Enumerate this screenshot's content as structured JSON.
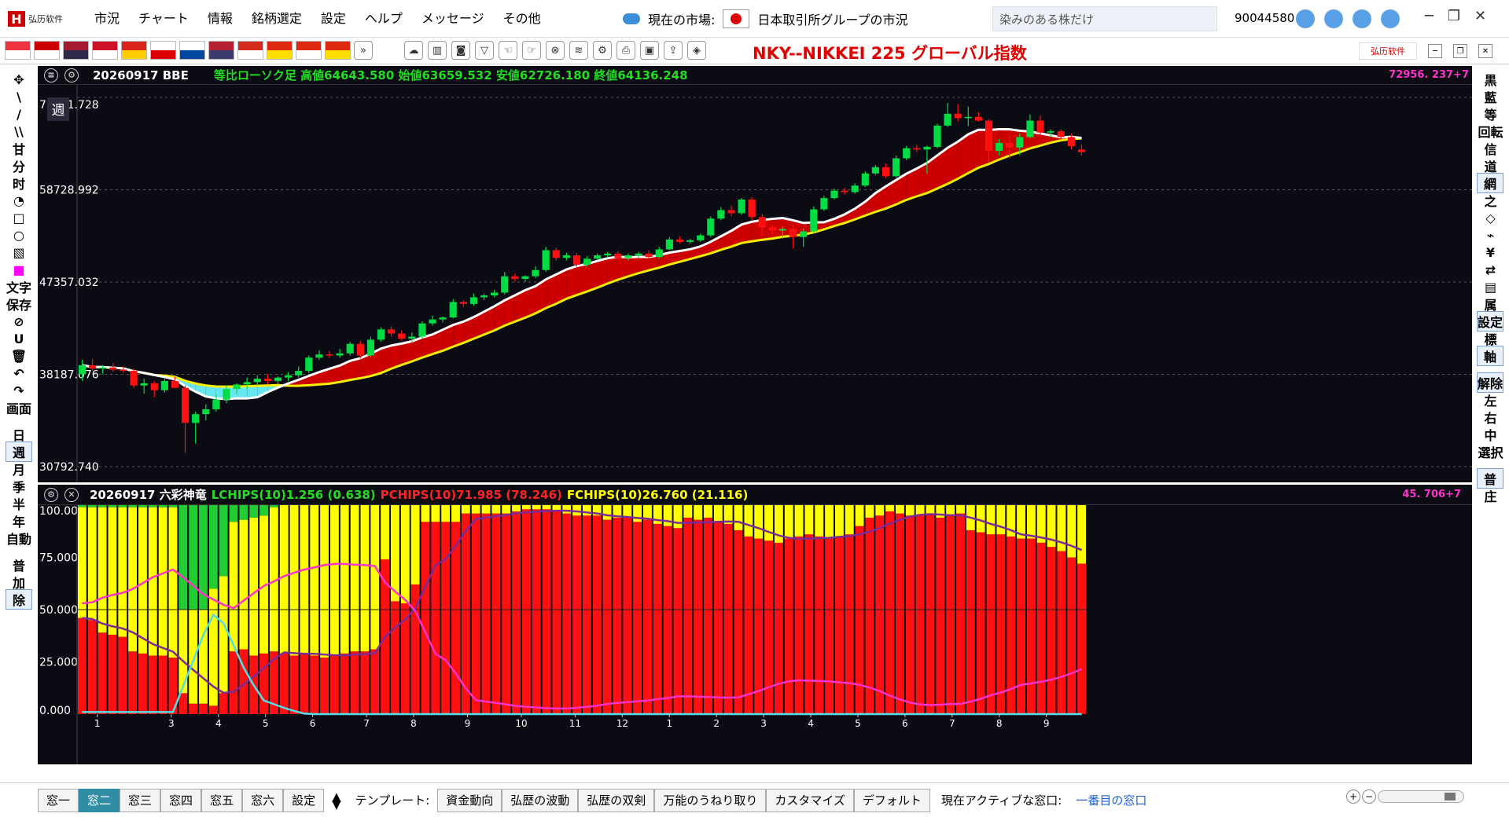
{
  "app": {
    "logo_text": "弘历软件",
    "menus": [
      "市況",
      "チャート",
      "情報",
      "銘柄選定",
      "設定",
      "ヘルプ",
      "メッセージ",
      "その他"
    ],
    "market_label": "現在の市場:",
    "market_name": "日本取引所グループの市況",
    "search_placeholder": "染みのある株だけ",
    "user_id": "90044580"
  },
  "toolbar": {
    "chart_title": "NKY--NIKKEI 225  グローバル指数",
    "flags": [
      "sg",
      "my",
      "th",
      "id",
      "vn",
      "jp",
      "kr",
      "us",
      "ca",
      "cn",
      "hk",
      "cn2"
    ]
  },
  "left_tools": [
    "✥",
    "\\",
    "/",
    "\\\\",
    "甘",
    "分",
    "时",
    "◔",
    "□",
    "○",
    "▧",
    "■",
    "文字",
    "保存",
    "⊘",
    "U",
    "🗑",
    "↶",
    "↷",
    "画面",
    "日",
    "週",
    "月",
    "季",
    "半",
    "年",
    "自動",
    "普",
    "加",
    "除"
  ],
  "right_tools": [
    "黒",
    "藍",
    "等",
    "回転",
    "信",
    "道",
    "網",
    "之",
    "◇",
    "⌁",
    "¥",
    "⇄",
    "▤",
    "属",
    "設定",
    "標",
    "軸",
    "解除",
    "左",
    "右",
    "中",
    "選択",
    "普",
    "庄"
  ],
  "upper": {
    "date_code": "20260917 BBE",
    "ohlc": "等比ローソク足 高値64643.580 始値63659.532 安値62726.180 終値64136.248",
    "right_value": "72956. 237+7",
    "period_badge": "週",
    "y_labels": [
      "72831.728",
      "58728.992",
      "47357.032",
      "38187.076",
      "30792.740"
    ]
  },
  "lower": {
    "date_code": "20260917 六彩神竜",
    "lchips": "LCHIPS(10)1.256 (0.638)",
    "pchips": "PCHIPS(10)71.985 (78.246)",
    "fchips": "FCHIPS(10)26.760 (21.116)",
    "right_value": "45. 706+7",
    "y_labels": [
      "100.000",
      "75.000",
      "50.000",
      "25.000",
      "0.000"
    ],
    "x_labels": [
      "1",
      "3",
      "4",
      "5",
      "6",
      "7",
      "8",
      "9",
      "10",
      "11",
      "12",
      "1",
      "2",
      "3",
      "4",
      "5",
      "6",
      "7",
      "8",
      "9"
    ]
  },
  "bottom": {
    "tabs": [
      "窓一",
      "窓二",
      "窓三",
      "窓四",
      "窓五",
      "窓六",
      "設定"
    ],
    "template_label": "テンプレート:",
    "templates": [
      "資金動向",
      "弘歴の波動",
      "弘歴の双剣",
      "万能のうねり取り",
      "カスタマイズ",
      "デフォルト"
    ],
    "active_label": "現在アクティブな窓口:",
    "active_value": "一番目の窓口"
  },
  "colors": {
    "up": "#00dd44",
    "down": "#ff1010",
    "yellow": "#ffff00",
    "white": "#ffffff",
    "cyan": "#55dde6",
    "magenta": "#ff33cc",
    "purple": "#7b2a9a"
  },
  "chart_data": [
    {
      "type": "candlestick",
      "ylim": [
        30792.74,
        72831.728
      ],
      "ylog": true,
      "y_ticks": [
        72831.728,
        58728.992,
        47357.032,
        38187.076,
        30792.74
      ],
      "candles": [
        [
          38200,
          39500,
          37600,
          39000
        ],
        [
          39000,
          39600,
          38500,
          38700
        ],
        [
          38700,
          39000,
          38200,
          38800
        ],
        [
          38800,
          39200,
          38400,
          38600
        ],
        [
          38600,
          38900,
          38300,
          38500
        ],
        [
          38500,
          38700,
          37000,
          37200
        ],
        [
          37200,
          37800,
          36500,
          37400
        ],
        [
          37400,
          37600,
          36200,
          36800
        ],
        [
          36800,
          37900,
          36600,
          37600
        ],
        [
          37600,
          38000,
          37200,
          37000
        ],
        [
          37000,
          37200,
          31800,
          34100
        ],
        [
          34100,
          35000,
          32500,
          34800
        ],
        [
          34800,
          35600,
          34300,
          35200
        ],
        [
          35200,
          36400,
          35000,
          36000
        ],
        [
          36000,
          37200,
          35700,
          36900
        ],
        [
          36900,
          37400,
          36500,
          37300
        ],
        [
          37300,
          37900,
          36900,
          37500
        ],
        [
          37500,
          38100,
          37200,
          37800
        ],
        [
          37800,
          38200,
          37300,
          37600
        ],
        [
          37600,
          38000,
          37300,
          37900
        ],
        [
          37900,
          38400,
          37600,
          38100
        ],
        [
          38100,
          38900,
          37900,
          38500
        ],
        [
          38500,
          39900,
          38300,
          39700
        ],
        [
          39700,
          40400,
          39500,
          40000
        ],
        [
          40000,
          40300,
          39700,
          39900
        ],
        [
          39900,
          40500,
          39700,
          40100
        ],
        [
          40100,
          41200,
          39900,
          41000
        ],
        [
          41000,
          41300,
          39600,
          39900
        ],
        [
          39900,
          41700,
          39700,
          41400
        ],
        [
          41400,
          42600,
          41200,
          42400
        ],
        [
          42400,
          42700,
          41700,
          42000
        ],
        [
          42000,
          42300,
          41300,
          41500
        ],
        [
          41500,
          42100,
          41100,
          41700
        ],
        [
          41700,
          43200,
          41500,
          43000
        ],
        [
          43000,
          43800,
          42800,
          43400
        ],
        [
          43400,
          43700,
          43100,
          43600
        ],
        [
          43600,
          45500,
          43500,
          45200
        ],
        [
          45200,
          45400,
          44700,
          45000
        ],
        [
          45000,
          46100,
          44800,
          45700
        ],
        [
          45700,
          46100,
          45400,
          45900
        ],
        [
          45900,
          46500,
          45700,
          46200
        ],
        [
          46200,
          48500,
          46000,
          48000
        ],
        [
          48000,
          48300,
          47400,
          47700
        ],
        [
          47700,
          48100,
          47400,
          48000
        ],
        [
          48000,
          49100,
          47800,
          48700
        ],
        [
          48700,
          51400,
          48500,
          51000
        ],
        [
          51000,
          51300,
          49800,
          50100
        ],
        [
          50100,
          50700,
          49800,
          50400
        ],
        [
          50400,
          50700,
          49100,
          49300
        ],
        [
          49300,
          50300,
          49100,
          50000
        ],
        [
          50000,
          50600,
          49800,
          50400
        ],
        [
          50400,
          50800,
          50100,
          50600
        ],
        [
          50600,
          50900,
          49900,
          50100
        ],
        [
          50100,
          50600,
          49800,
          50400
        ],
        [
          50400,
          50800,
          50100,
          50600
        ],
        [
          50600,
          51000,
          50000,
          50200
        ],
        [
          50200,
          51400,
          50000,
          51100
        ],
        [
          51100,
          52600,
          51000,
          52300
        ],
        [
          52300,
          52700,
          51800,
          52000
        ],
        [
          52000,
          52400,
          51800,
          52200
        ],
        [
          52200,
          53000,
          52000,
          52800
        ],
        [
          52800,
          55200,
          52600,
          54900
        ],
        [
          54900,
          56400,
          54700,
          56000
        ],
        [
          56000,
          56600,
          55200,
          55600
        ],
        [
          55600,
          57600,
          55400,
          57400
        ],
        [
          57400,
          57700,
          54700,
          55100
        ],
        [
          55100,
          55500,
          52800,
          53800
        ],
        [
          53800,
          54100,
          52700,
          53400
        ],
        [
          53400,
          53900,
          52400,
          53600
        ],
        [
          53600,
          54200,
          51200,
          52600
        ],
        [
          52600,
          53700,
          51400,
          53300
        ],
        [
          53300,
          56500,
          53100,
          56100
        ],
        [
          56100,
          57900,
          55900,
          57600
        ],
        [
          57600,
          58900,
          57400,
          58600
        ],
        [
          58600,
          59000,
          58100,
          58400
        ],
        [
          58400,
          59600,
          58200,
          59300
        ],
        [
          59300,
          61300,
          59100,
          61000
        ],
        [
          61000,
          62200,
          60800,
          61900
        ],
        [
          61900,
          62400,
          60300,
          60600
        ],
        [
          60600,
          63600,
          60400,
          63200
        ],
        [
          63200,
          65000,
          62900,
          64700
        ],
        [
          64700,
          65200,
          64100,
          64500
        ],
        [
          64500,
          65100,
          61000,
          64900
        ],
        [
          64900,
          68500,
          64700,
          68200
        ],
        [
          68200,
          71900,
          68000,
          70100
        ],
        [
          70100,
          71700,
          68900,
          69400
        ],
        [
          69400,
          71300,
          68100,
          69600
        ],
        [
          69600,
          70400,
          68800,
          69000
        ],
        [
          69000,
          69300,
          62600,
          64300
        ],
        [
          64300,
          66100,
          63600,
          65500
        ],
        [
          65500,
          66800,
          63200,
          64800
        ],
        [
          64800,
          67000,
          63700,
          66400
        ],
        [
          66400,
          70000,
          66200,
          69000
        ],
        [
          69000,
          69800,
          66600,
          67100
        ],
        [
          67100,
          67600,
          66400,
          67300
        ],
        [
          67300,
          67600,
          66000,
          66400
        ],
        [
          66400,
          66900,
          64500,
          65000
        ],
        [
          64500,
          65300,
          63600,
          64100
        ]
      ]
    },
    {
      "type": "bar",
      "stacked": true,
      "ylim": [
        0,
        100
      ],
      "series": [
        {
          "name": "PCHIPS",
          "values": [
            46,
            45,
            39,
            38,
            37,
            30,
            29,
            28,
            28,
            27,
            10,
            5,
            5,
            4,
            10,
            30,
            31,
            28,
            29,
            30,
            29,
            28,
            29,
            28,
            27,
            28,
            29,
            30,
            30,
            31,
            74,
            54,
            53,
            62,
            92,
            92,
            92,
            92,
            96,
            96,
            96,
            96,
            96,
            97,
            98,
            98,
            98,
            97,
            96,
            95,
            95,
            95,
            93,
            94,
            94,
            92,
            93,
            91,
            90,
            89,
            94,
            93,
            94,
            92,
            91,
            88,
            85,
            84,
            83,
            82,
            84,
            85,
            86,
            85,
            84,
            85,
            86,
            90,
            94,
            95,
            97,
            96,
            95,
            95,
            96,
            94,
            95,
            96,
            88,
            87,
            86,
            86,
            85,
            84,
            84,
            82,
            80,
            78,
            75,
            72
          ]
        },
        {
          "name": "FCHIPS",
          "values": [
            53,
            54,
            60,
            61,
            62,
            69,
            70,
            71,
            71,
            72,
            40,
            45,
            45,
            56,
            56,
            62,
            62,
            66,
            66,
            69,
            71,
            72,
            71,
            72,
            73,
            72,
            71,
            70,
            70,
            69,
            26,
            46,
            47,
            38,
            8,
            8,
            8,
            8,
            4,
            4,
            4,
            4,
            4,
            3,
            2,
            2,
            2,
            3,
            4,
            5,
            5,
            5,
            7,
            6,
            6,
            8,
            7,
            9,
            10,
            11,
            6,
            7,
            6,
            8,
            9,
            12,
            15,
            16,
            17,
            18,
            16,
            15,
            14,
            15,
            16,
            15,
            14,
            10,
            6,
            5,
            3,
            4,
            5,
            5,
            4,
            6,
            5,
            4,
            12,
            13,
            14,
            14,
            15,
            16,
            16,
            18,
            20,
            22,
            25,
            28
          ]
        },
        {
          "name": "LCHIPS",
          "values": [
            1,
            1,
            1,
            1,
            1,
            1,
            1,
            1,
            1,
            1,
            50,
            50,
            50,
            40,
            34,
            8,
            7,
            6,
            5,
            1,
            0,
            0,
            0,
            0,
            0,
            0,
            0,
            0,
            0,
            0,
            0,
            0,
            0,
            0,
            0,
            0,
            0,
            0,
            0,
            0,
            0,
            0,
            0,
            0,
            0,
            0,
            0,
            0,
            0,
            0,
            0,
            0,
            0,
            0,
            0,
            0,
            0,
            0,
            0,
            0,
            0,
            0,
            0,
            0,
            0,
            0,
            0,
            0,
            0,
            0,
            0,
            0,
            0,
            0,
            0,
            0,
            0,
            0,
            0,
            0,
            0,
            0,
            0,
            0,
            0,
            0,
            0,
            0,
            0,
            0,
            0,
            0,
            0,
            0,
            0,
            0,
            0,
            0,
            0,
            0
          ]
        }
      ]
    }
  ]
}
